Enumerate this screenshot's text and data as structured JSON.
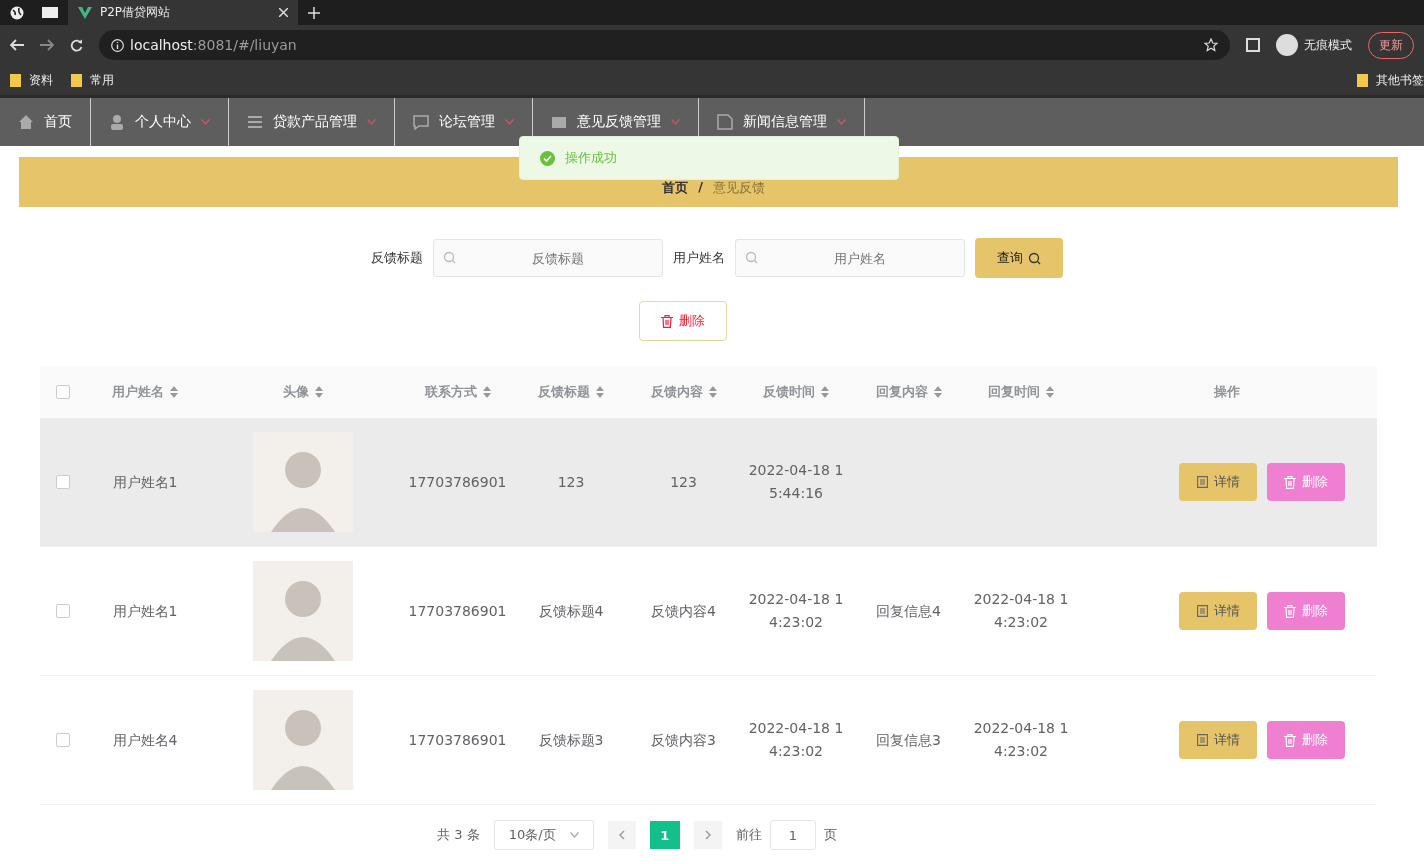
{
  "browser": {
    "tab_title": "P2P借贷网站",
    "url_host": "localhost",
    "url_rest": ":8081/#/liuyan",
    "profile": "无痕模式",
    "update": "更新",
    "bookmarks": [
      "资料",
      "常用"
    ],
    "other_bookmarks": "其他书签"
  },
  "nav": {
    "items": [
      {
        "label": "首页"
      },
      {
        "label": "个人中心"
      },
      {
        "label": "贷款产品管理"
      },
      {
        "label": "论坛管理"
      },
      {
        "label": "意见反馈管理"
      },
      {
        "label": "新闻信息管理"
      }
    ]
  },
  "toast": {
    "message": "操作成功"
  },
  "breadcrumb": {
    "items": [
      "首页",
      "意见反馈"
    ],
    "separator": "/"
  },
  "search": {
    "fields": [
      {
        "label": "反馈标题",
        "placeholder": "反馈标题"
      },
      {
        "label": "用户姓名",
        "placeholder": "用户姓名"
      }
    ],
    "button": "查询"
  },
  "delete_button": "删除",
  "table": {
    "all_checked": false,
    "columns": [
      "用户姓名",
      "头像",
      "联系方式",
      "反馈标题",
      "反馈内容",
      "反馈时间",
      "回复内容",
      "回复时间",
      "操作"
    ],
    "rows": [
      {
        "highlighted": true,
        "checked": false,
        "cells": [
          "用户姓名1",
          "",
          "17703786901",
          "123",
          "123",
          "2022-04-18 15:44:16",
          "",
          ""
        ],
        "actions": [
          "详情",
          "删除"
        ]
      },
      {
        "highlighted": false,
        "checked": false,
        "cells": [
          "用户姓名1",
          "",
          "17703786901",
          "反馈标题4",
          "反馈内容4",
          "2022-04-18 14:23:02",
          "回复信息4",
          "2022-04-18 14:23:02"
        ],
        "actions": [
          "详情",
          "删除"
        ]
      },
      {
        "highlighted": false,
        "checked": false,
        "cells": [
          "用户姓名4",
          "",
          "17703786901",
          "反馈标题3",
          "反馈内容3",
          "2022-04-18 14:23:02",
          "回复信息3",
          "2022-04-18 14:23:02"
        ],
        "actions": [
          "详情",
          "删除"
        ]
      }
    ]
  },
  "pagination": {
    "total": "共 3 条",
    "page_size": "10条/页",
    "pages": [
      {
        "label": "1",
        "selected": true
      }
    ],
    "goto_label": "前往",
    "goto_value": "1",
    "goto_suffix": "页"
  }
}
